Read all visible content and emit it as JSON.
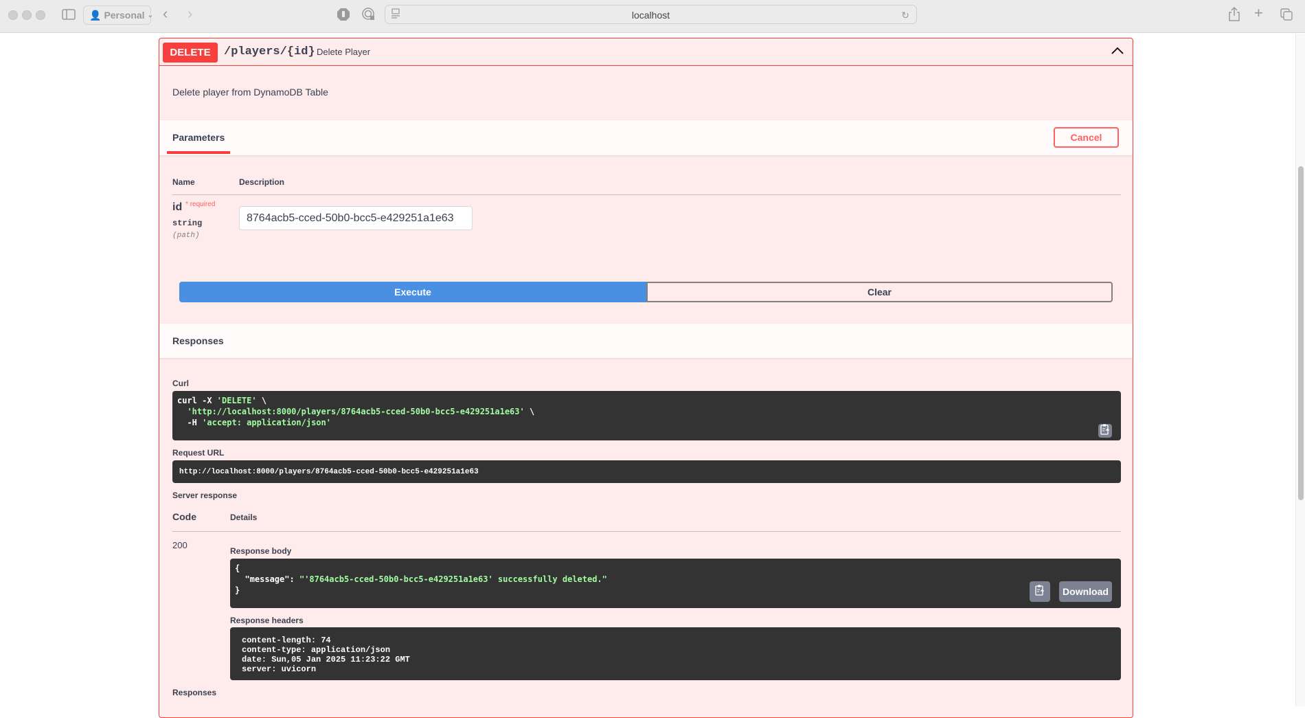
{
  "browser": {
    "profile": "Personal",
    "address": "localhost"
  },
  "operation": {
    "method": "DELETE",
    "path": "/players/{id}",
    "summary": "Delete Player",
    "description": "Delete player from DynamoDB Table",
    "colors": {
      "method": "#f93e3e",
      "execute": "#4990e2"
    }
  },
  "parameters": {
    "tab_label": "Parameters",
    "cancel_label": "Cancel",
    "col_name": "Name",
    "col_description": "Description",
    "items": [
      {
        "name": "id",
        "required_mark": "*",
        "required_label": "required",
        "type": "string",
        "in": "(path)",
        "value": "8764acb5-cced-50b0-bcc5-e429251a1e63"
      }
    ]
  },
  "actions": {
    "execute_label": "Execute",
    "clear_label": "Clear"
  },
  "responses": {
    "title": "Responses",
    "curl_label": "Curl",
    "curl": {
      "line1_cmd": "curl -X ",
      "line1_method": "'DELETE'",
      "line1_tail": " \\",
      "line2_url": "'http://localhost:8000/players/8764acb5-cced-50b0-bcc5-e429251a1e63'",
      "line2_tail": " \\",
      "line3_flag": "-H ",
      "line3_header": "'accept: application/json'"
    },
    "request_url_label": "Request URL",
    "request_url": "http://localhost:8000/players/8764acb5-cced-50b0-bcc5-e429251a1e63",
    "server_response_label": "Server response",
    "col_code": "Code",
    "col_details": "Details",
    "code": "200",
    "response_body_label": "Response body",
    "response_body": {
      "open": "{",
      "key": "\"message\"",
      "sep": ": ",
      "value": "\"'8764acb5-cced-50b0-bcc5-e429251a1e63' successfully deleted.\"",
      "close": "}"
    },
    "download_label": "Download",
    "response_headers_label": "Response headers",
    "response_headers": [
      "content-length: 74",
      "content-type: application/json",
      "date: Sun,05 Jan 2025 11:23:22 GMT",
      "server: uvicorn"
    ],
    "bottom_title": "Responses"
  }
}
